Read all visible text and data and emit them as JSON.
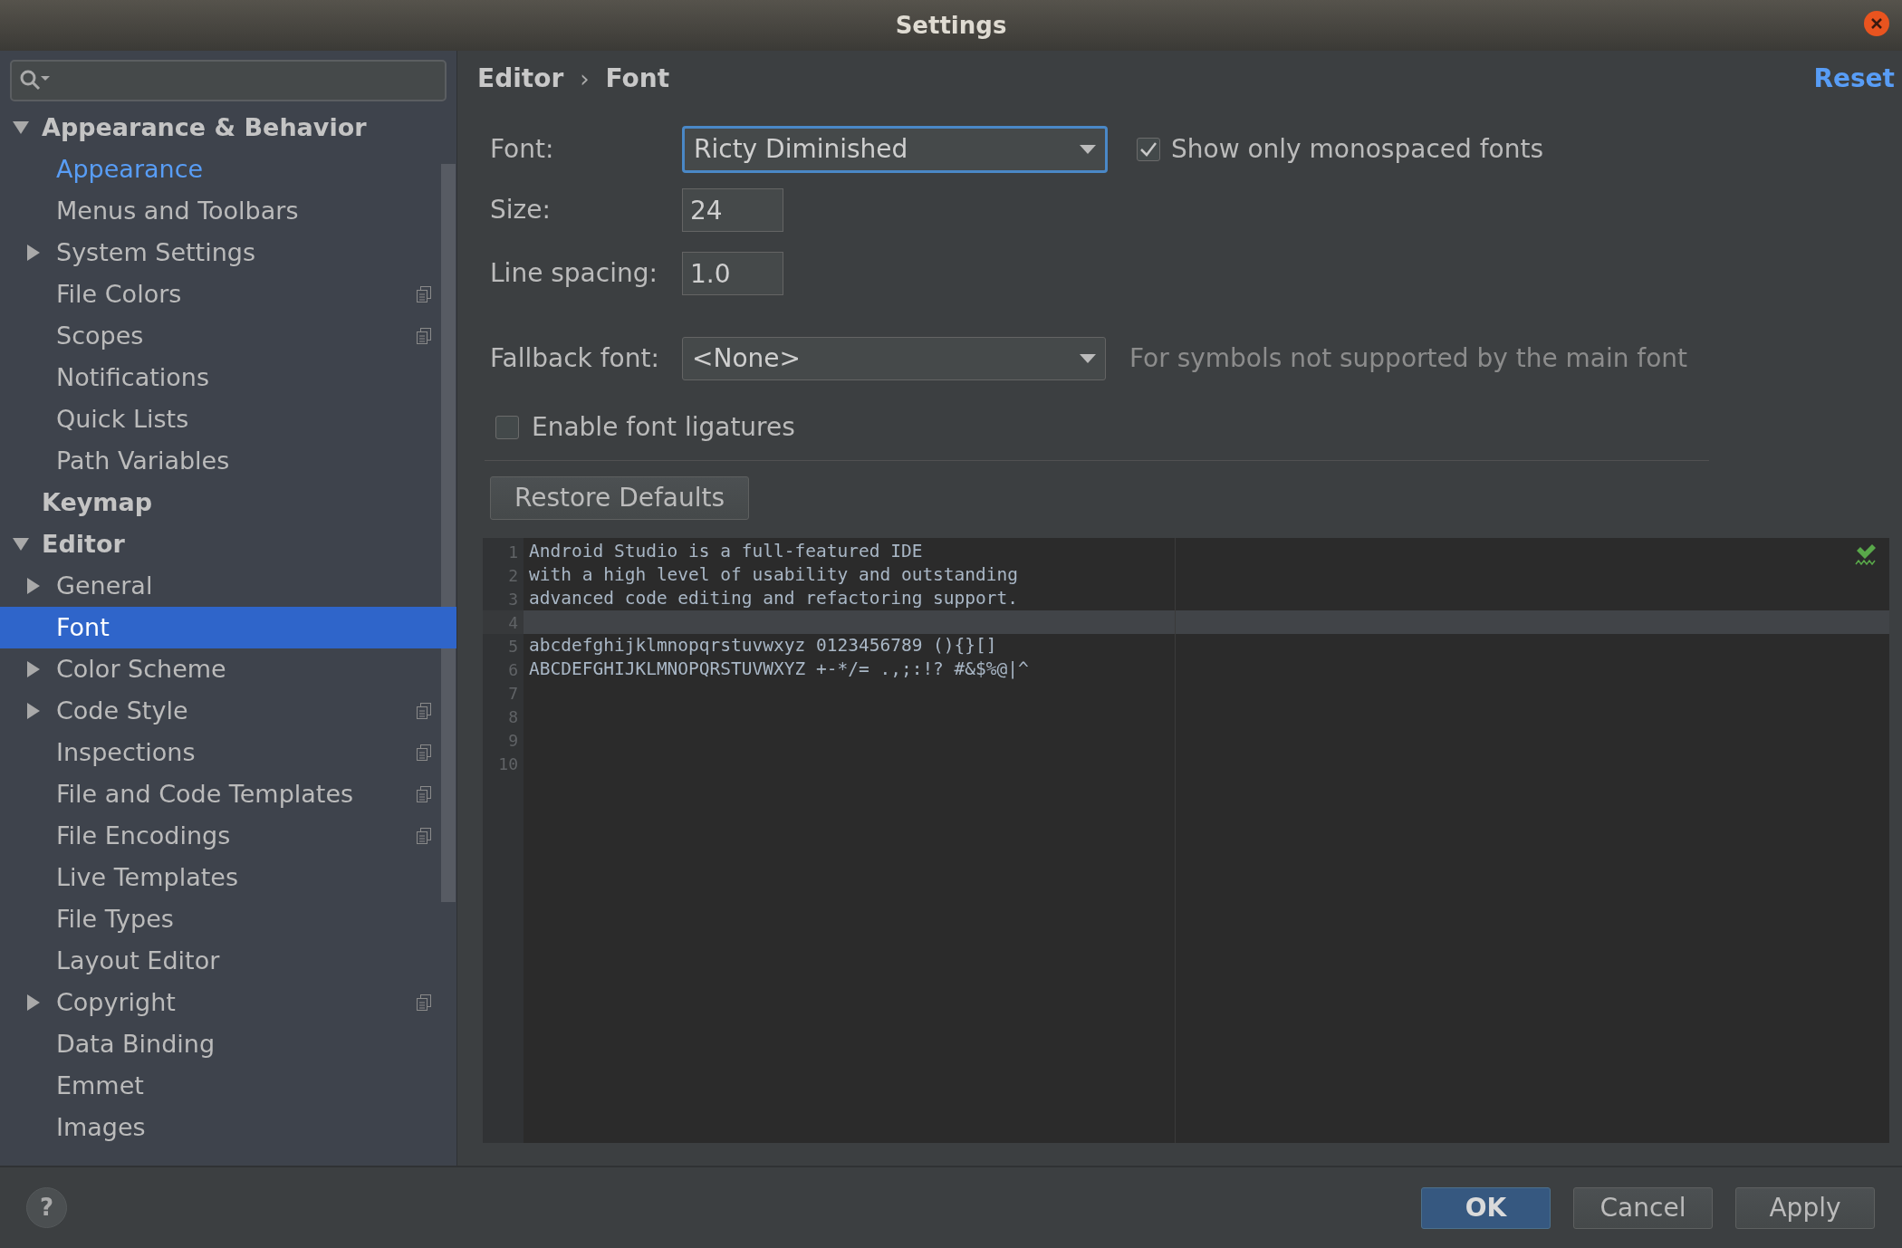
{
  "window": {
    "title": "Settings"
  },
  "sidebar": {
    "items": [
      {
        "label": "Appearance & Behavior",
        "expanded": true,
        "highlighted": false,
        "selected": false,
        "scoped": false,
        "children": [
          {
            "label": "Appearance",
            "highlighted": true,
            "selected": false,
            "scoped": false
          },
          {
            "label": "Menus and Toolbars",
            "highlighted": false,
            "selected": false,
            "scoped": false
          },
          {
            "label": "System Settings",
            "expanded": false,
            "highlighted": false,
            "selected": false,
            "scoped": false
          },
          {
            "label": "File Colors",
            "highlighted": false,
            "selected": false,
            "scoped": true
          },
          {
            "label": "Scopes",
            "highlighted": false,
            "selected": false,
            "scoped": true
          },
          {
            "label": "Notifications",
            "highlighted": false,
            "selected": false,
            "scoped": false
          },
          {
            "label": "Quick Lists",
            "highlighted": false,
            "selected": false,
            "scoped": false
          },
          {
            "label": "Path Variables",
            "highlighted": false,
            "selected": false,
            "scoped": false
          }
        ]
      },
      {
        "label": "Keymap",
        "highlighted": false,
        "selected": false,
        "scoped": false
      },
      {
        "label": "Editor",
        "expanded": true,
        "highlighted": false,
        "selected": false,
        "scoped": false,
        "children": [
          {
            "label": "General",
            "expanded": false,
            "highlighted": false,
            "selected": false,
            "scoped": false
          },
          {
            "label": "Font",
            "highlighted": false,
            "selected": true,
            "scoped": false
          },
          {
            "label": "Color Scheme",
            "expanded": false,
            "highlighted": false,
            "selected": false,
            "scoped": false
          },
          {
            "label": "Code Style",
            "expanded": false,
            "highlighted": false,
            "selected": false,
            "scoped": true
          },
          {
            "label": "Inspections",
            "highlighted": false,
            "selected": false,
            "scoped": true
          },
          {
            "label": "File and Code Templates",
            "highlighted": false,
            "selected": false,
            "scoped": true
          },
          {
            "label": "File Encodings",
            "highlighted": false,
            "selected": false,
            "scoped": true
          },
          {
            "label": "Live Templates",
            "highlighted": false,
            "selected": false,
            "scoped": false
          },
          {
            "label": "File Types",
            "highlighted": false,
            "selected": false,
            "scoped": false
          },
          {
            "label": "Layout Editor",
            "highlighted": false,
            "selected": false,
            "scoped": false
          },
          {
            "label": "Copyright",
            "expanded": false,
            "highlighted": false,
            "selected": false,
            "scoped": true
          },
          {
            "label": "Data Binding",
            "highlighted": false,
            "selected": false,
            "scoped": false
          },
          {
            "label": "Emmet",
            "highlighted": false,
            "selected": false,
            "scoped": false
          },
          {
            "label": "Images",
            "highlighted": false,
            "selected": false,
            "scoped": false
          }
        ]
      }
    ]
  },
  "breadcrumb": [
    "Editor",
    "Font"
  ],
  "breadcrumb_separator": "›",
  "reset": "Reset",
  "font": {
    "label": "Font:",
    "value": "Ricty Diminished",
    "focused": true
  },
  "monospaced": {
    "label": "Show only monospaced fonts",
    "checked": true
  },
  "size": {
    "label": "Size:",
    "value": "24"
  },
  "line_spacing": {
    "label": "Line spacing:",
    "value": "1.0"
  },
  "fallback": {
    "label": "Fallback font:",
    "value": "<None>",
    "hint": "For symbols not supported by the main font"
  },
  "ligatures": {
    "label": "Enable font ligatures",
    "checked": false
  },
  "restore_defaults": "Restore Defaults",
  "preview": {
    "lines": [
      {
        "number": "1",
        "text": "Android Studio is a full-featured IDE",
        "current": false
      },
      {
        "number": "2",
        "text": "with a high level of usability and outstanding",
        "current": false
      },
      {
        "number": "3",
        "text": "advanced code editing and refactoring support.",
        "current": false
      },
      {
        "number": "4",
        "current": true
      },
      {
        "number": "5",
        "text": "abcdefghijklmnopqrstuvwxyz 0123456789 (){}[]",
        "current": false
      },
      {
        "number": "6",
        "text": "ABCDEFGHIJKLMNOPQRSTUVWXYZ +-*/= .,;:!? #&$%@|^",
        "current": false
      },
      {
        "number": "7",
        "current": false
      },
      {
        "number": "8",
        "current": false
      },
      {
        "number": "9",
        "current": false
      },
      {
        "number": "10",
        "current": false
      }
    ]
  },
  "help": "?",
  "buttons": [
    {
      "label": "OK",
      "default": true
    },
    {
      "label": "Cancel",
      "default": false
    },
    {
      "label": "Apply",
      "default": false
    }
  ]
}
